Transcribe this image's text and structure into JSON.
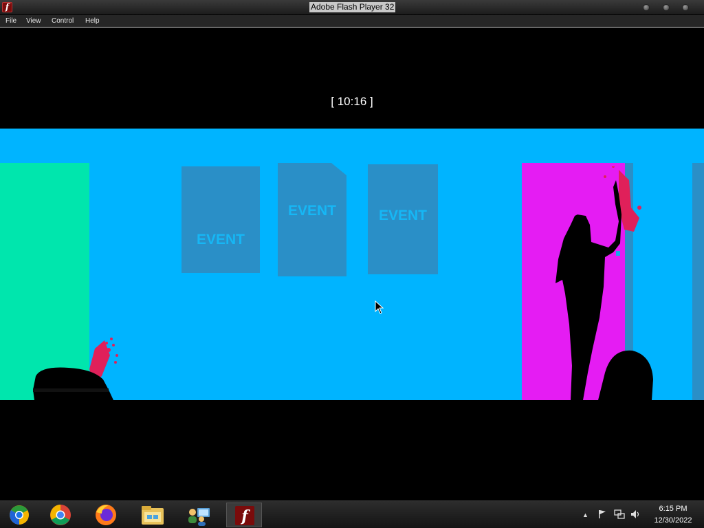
{
  "window": {
    "title": "Adobe Flash Player 32",
    "app_icon_glyph": "f"
  },
  "menu": {
    "items": [
      {
        "label": "File"
      },
      {
        "label": "View"
      },
      {
        "label": "Control"
      },
      {
        "label": "Help"
      }
    ]
  },
  "game": {
    "timer": "[ 10:16 ]",
    "event_cards": [
      {
        "label": "EVENT"
      },
      {
        "label": "EVENT"
      },
      {
        "label": "EVENT"
      }
    ],
    "colors": {
      "background": "#00b4ff",
      "left_panel": "#00e6ad",
      "door": "#e51cf3",
      "cards": "#2a8fc7",
      "blood": "#e0205a"
    }
  },
  "taskbar": {
    "apps": [
      {
        "name": "chrome-canary-icon"
      },
      {
        "name": "chrome-icon"
      },
      {
        "name": "firefox-icon"
      },
      {
        "name": "file-explorer-icon"
      },
      {
        "name": "network-users-icon"
      },
      {
        "name": "flash-player-icon",
        "active": true
      }
    ],
    "tray": {
      "icons": [
        "show-hidden-icons-icon",
        "action-center-flag-icon",
        "network-icon",
        "volume-icon"
      ]
    },
    "clock": {
      "time": "6:15 PM",
      "date": "12/30/2022"
    }
  }
}
